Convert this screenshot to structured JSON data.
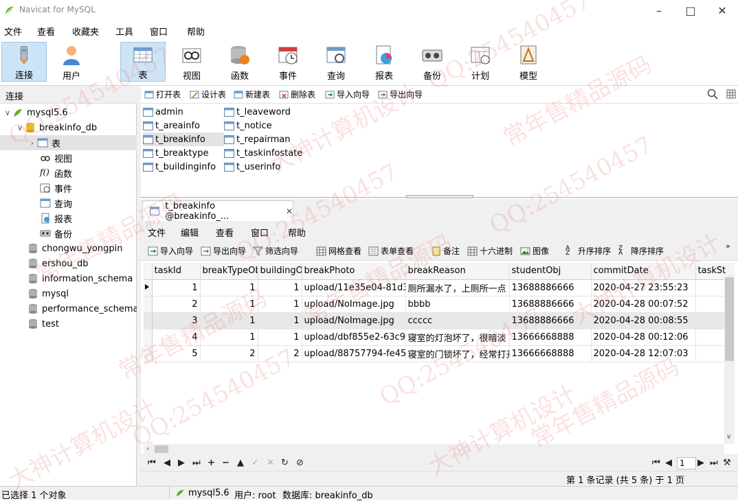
{
  "window": {
    "title": "Navicat for MySQL",
    "minimize": "–",
    "maximize": "□",
    "close": "✕"
  },
  "menubar": [
    "文件",
    "查看",
    "收藏夹",
    "工具",
    "窗口",
    "帮助"
  ],
  "toolbar": [
    {
      "label": "连接",
      "icon": "connect-icon"
    },
    {
      "label": "用户",
      "icon": "user-icon"
    },
    {
      "label": "表",
      "icon": "table-icon",
      "active": true
    },
    {
      "label": "视图",
      "icon": "view-icon"
    },
    {
      "label": "函数",
      "icon": "function-icon"
    },
    {
      "label": "事件",
      "icon": "event-icon"
    },
    {
      "label": "查询",
      "icon": "query-icon"
    },
    {
      "label": "报表",
      "icon": "report-icon"
    },
    {
      "label": "备份",
      "icon": "backup-icon"
    },
    {
      "label": "计划",
      "icon": "schedule-icon"
    },
    {
      "label": "模型",
      "icon": "model-icon"
    }
  ],
  "left": {
    "header": "连接",
    "tree": [
      {
        "label": "mysql5.6",
        "level": 0,
        "arrow": "∨",
        "icon": "connection"
      },
      {
        "label": "breakinfo_db",
        "level": 1,
        "arrow": "∨",
        "icon": "database"
      },
      {
        "label": "表",
        "level": 2,
        "arrow": "›",
        "icon": "table",
        "selected": true
      },
      {
        "label": "视图",
        "level": 2,
        "arrow": "",
        "icon": "view"
      },
      {
        "label": "函数",
        "level": 2,
        "arrow": "",
        "icon": "function"
      },
      {
        "label": "事件",
        "level": 2,
        "arrow": "",
        "icon": "event"
      },
      {
        "label": "查询",
        "level": 2,
        "arrow": "",
        "icon": "query"
      },
      {
        "label": "报表",
        "level": 2,
        "arrow": "",
        "icon": "report"
      },
      {
        "label": "备份",
        "level": 2,
        "arrow": "",
        "icon": "backup"
      },
      {
        "label": "chongwu_yongpin",
        "level": 1,
        "arrow": "",
        "icon": "database-gray"
      },
      {
        "label": "ershou_db",
        "level": 1,
        "arrow": "",
        "icon": "database-gray"
      },
      {
        "label": "information_schema",
        "level": 1,
        "arrow": "",
        "icon": "database-gray"
      },
      {
        "label": "mysql",
        "level": 1,
        "arrow": "",
        "icon": "database-gray"
      },
      {
        "label": "performance_schema",
        "level": 1,
        "arrow": "",
        "icon": "database-gray"
      },
      {
        "label": "test",
        "level": 1,
        "arrow": "",
        "icon": "database-gray"
      }
    ]
  },
  "objtoolbar": [
    "打开表",
    "设计表",
    "新建表",
    "删除表",
    "导入向导",
    "导出向导"
  ],
  "tables_col1": [
    "admin",
    "t_areainfo",
    "t_breakinfo",
    "t_breaktype",
    "t_buildinginfo"
  ],
  "tables_col2": [
    "t_leaveword",
    "t_notice",
    "t_repairman",
    "t_taskinfostate",
    "t_userinfo"
  ],
  "tab": {
    "label": "t_breakinfo @breakinfo_...",
    "close": "✕"
  },
  "innermenu": [
    "文件",
    "编辑",
    "查看",
    "窗口",
    "帮助"
  ],
  "innertoolbar": [
    "导入向导",
    "导出向导",
    "筛选向导",
    "网格查看",
    "表单查看",
    "备注",
    "十六进制",
    "图像",
    "升序排序",
    "降序排序"
  ],
  "grid": {
    "columns": [
      "taskId",
      "breakTypeOb",
      "buildingO",
      "breakPhoto",
      "breakReason",
      "studentObj",
      "commitDate",
      "taskSt"
    ],
    "rows": [
      [
        "1",
        "1",
        "1",
        "upload/11e35e04-81d3",
        "厕所漏水了，上厕所一点",
        "13688886666",
        "2020-04-27 23:55:23",
        ""
      ],
      [
        "2",
        "1",
        "1",
        "upload/NoImage.jpg",
        "bbbb",
        "13688886666",
        "2020-04-28 00:07:52",
        ""
      ],
      [
        "3",
        "1",
        "1",
        "upload/NoImage.jpg",
        "ccccc",
        "13688886666",
        "2020-04-28 00:08:55",
        ""
      ],
      [
        "4",
        "1",
        "1",
        "upload/dbf855e2-63c9",
        "寝室的灯泡坏了，很暗淡",
        "13666668888",
        "2020-04-28 00:12:06",
        ""
      ],
      [
        "5",
        "2",
        "2",
        "upload/88757794-fe45",
        "寝室的门锁坏了，经常打开",
        "13666668888",
        "2020-04-28 12:07:03",
        ""
      ]
    ]
  },
  "nav": {
    "page": "1"
  },
  "record_info": "第 1 条记录 (共 5 条) 于 1 页",
  "status": {
    "selection": "已选择 1 个对象",
    "connection": "mysql5.6",
    "user": "用户: root",
    "database": "数据库: breakinfo_db"
  },
  "watermarks": [
    "QQ:254540457",
    "常年售精品源码",
    "大神计算机设计"
  ]
}
